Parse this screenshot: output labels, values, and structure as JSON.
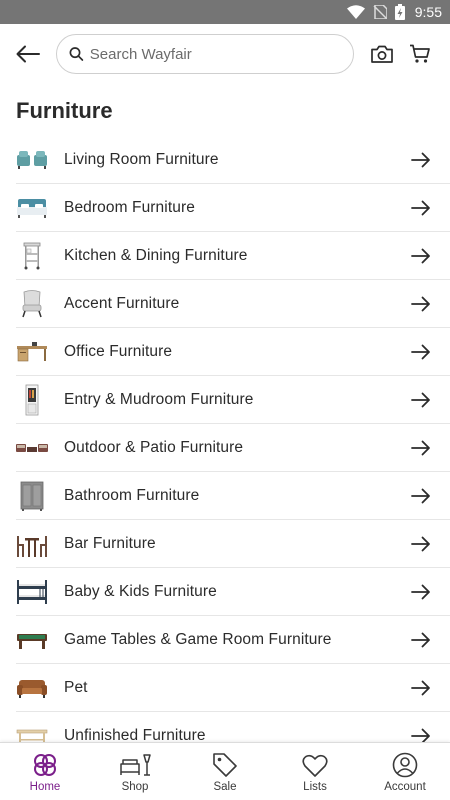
{
  "status_bar": {
    "time": "9:55"
  },
  "header": {
    "search_placeholder": "Search Wayfair"
  },
  "page": {
    "title": "Furniture"
  },
  "categories": [
    {
      "label": "Living Room Furniture",
      "icon": "sofa-thumbnail"
    },
    {
      "label": "Bedroom Furniture",
      "icon": "bed-thumbnail"
    },
    {
      "label": "Kitchen & Dining Furniture",
      "icon": "kitchen-cart-thumbnail"
    },
    {
      "label": "Accent Furniture",
      "icon": "accent-chair-thumbnail"
    },
    {
      "label": "Office Furniture",
      "icon": "desk-thumbnail"
    },
    {
      "label": "Entry & Mudroom Furniture",
      "icon": "cabinet-thumbnail"
    },
    {
      "label": "Outdoor & Patio Furniture",
      "icon": "patio-set-thumbnail"
    },
    {
      "label": "Bathroom Furniture",
      "icon": "bath-cabinet-thumbnail"
    },
    {
      "label": "Bar Furniture",
      "icon": "bar-set-thumbnail"
    },
    {
      "label": "Baby & Kids Furniture",
      "icon": "bunk-bed-thumbnail"
    },
    {
      "label": "Game Tables & Game Room Furniture",
      "icon": "pool-table-thumbnail"
    },
    {
      "label": "Pet",
      "icon": "pet-sofa-thumbnail"
    },
    {
      "label": "Unfinished Furniture",
      "icon": "bench-thumbnail"
    }
  ],
  "bottom_nav": {
    "items": [
      {
        "label": "Home",
        "icon": "home-icon",
        "active": true
      },
      {
        "label": "Shop",
        "icon": "shop-icon",
        "active": false
      },
      {
        "label": "Sale",
        "icon": "sale-tag-icon",
        "active": false
      },
      {
        "label": "Lists",
        "icon": "heart-icon",
        "active": false
      },
      {
        "label": "Account",
        "icon": "account-icon",
        "active": false
      }
    ]
  },
  "colors": {
    "accent": "#7b1f8a",
    "status_bar": "#757575",
    "text": "#2b2b2b"
  }
}
